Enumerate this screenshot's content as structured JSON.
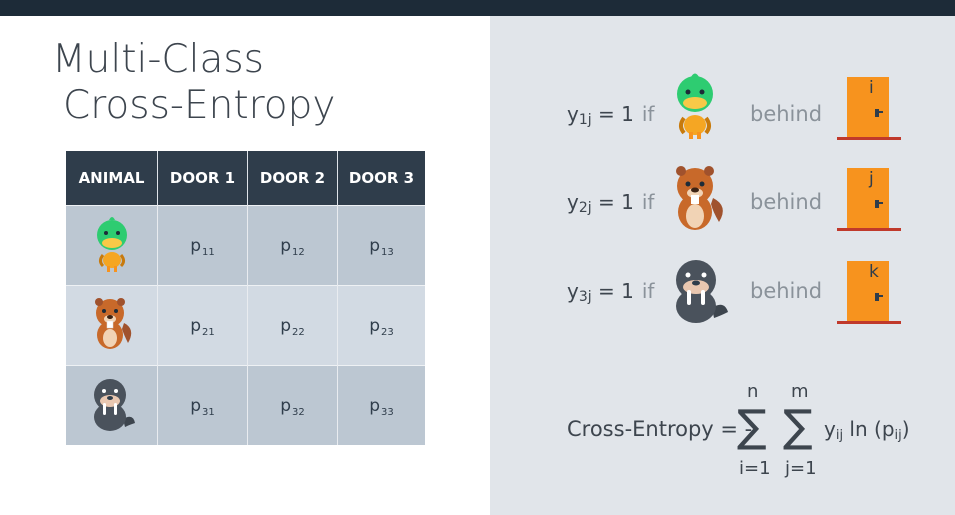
{
  "slide": {
    "title_line1": "Multi-Class",
    "title_line2": "Cross-Entropy"
  },
  "table": {
    "headers": [
      "ANIMAL",
      "DOOR 1",
      "DOOR 2",
      "DOOR 3"
    ],
    "rows": [
      {
        "animal_icon": "duck-icon",
        "cells": [
          {
            "base": "p",
            "sub": "11"
          },
          {
            "base": "p",
            "sub": "12"
          },
          {
            "base": "p",
            "sub": "13"
          }
        ]
      },
      {
        "animal_icon": "beaver-icon",
        "cells": [
          {
            "base": "p",
            "sub": "21"
          },
          {
            "base": "p",
            "sub": "22"
          },
          {
            "base": "p",
            "sub": "23"
          }
        ]
      },
      {
        "animal_icon": "walrus-icon",
        "cells": [
          {
            "base": "p",
            "sub": "31"
          },
          {
            "base": "p",
            "sub": "32"
          },
          {
            "base": "p",
            "sub": "33"
          }
        ]
      }
    ]
  },
  "definitions": [
    {
      "y": "y",
      "sub": "1j",
      "eq": "= 1",
      "if": "if",
      "animal_icon": "duck-icon",
      "behind": "behind",
      "door_label": "i"
    },
    {
      "y": "y",
      "sub": "2j",
      "eq": "= 1",
      "if": "if",
      "animal_icon": "beaver-icon",
      "behind": "behind",
      "door_label": "j"
    },
    {
      "y": "y",
      "sub": "3j",
      "eq": "= 1",
      "if": "if",
      "animal_icon": "walrus-icon",
      "behind": "behind",
      "door_label": "k"
    }
  ],
  "formula": {
    "lhs": "Cross-Entropy = -",
    "sum1_upper": "n",
    "sum1_lower": "i=1",
    "sum2_upper": "m",
    "sum2_lower": "j=1",
    "sigma": "∑",
    "term_y": "y",
    "term_y_sub": "ij",
    "term_ln": " ln (p",
    "term_p_sub": "ij",
    "term_close": ")"
  },
  "colors": {
    "topbar": "#1d2b38",
    "right_panel": "#e1e5ea",
    "table_header": "#2f3d4b",
    "door_orange": "#f7931e",
    "duck_green": "#2ecc71"
  }
}
